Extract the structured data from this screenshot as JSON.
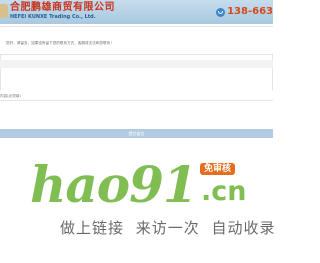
{
  "header": {
    "company_name_cn": "合肥鹏雄商贸有限公司",
    "company_name_en": "HEFEI KUNXE Trading Co., Ltd.",
    "hotline_number": "138-663"
  },
  "form": {
    "intro_text": "您好，请留言，如果没有留下您的联系方式，客服将无法和您联系！",
    "message_label": "内容(必须填)",
    "submit_label": "提交留言"
  },
  "promo": {
    "brand_name": "hao91",
    "domain_suffix": ".cn",
    "badge_text": "免审核",
    "slogan": "做上链接 来访一次 自动收录"
  },
  "colors": {
    "header_bg": "#b8d3e7",
    "company_cn": "#c9341e",
    "hotline": "#d24a1d",
    "submit_bar": "#b3cbe2",
    "brand_green": "#80bd52",
    "badge_orange": "#e46d1e"
  }
}
